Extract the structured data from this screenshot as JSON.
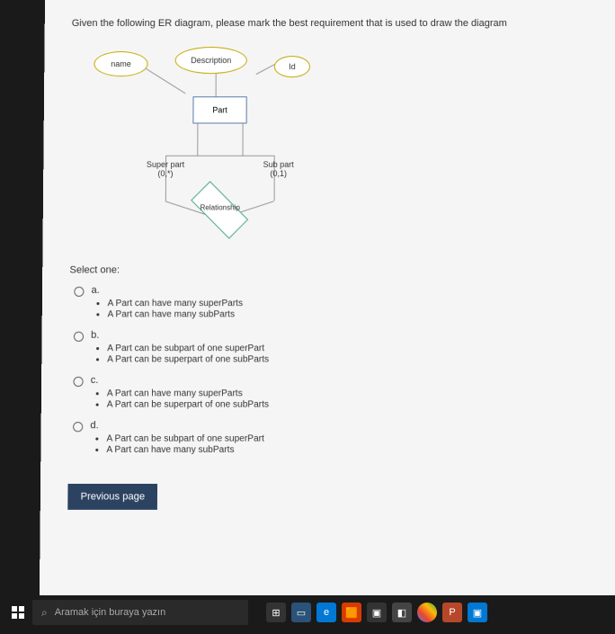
{
  "question": "Given the following ER diagram, please mark the best requirement that is used to draw the diagram",
  "diagram": {
    "attr_name": "name",
    "attr_desc": "Description",
    "attr_id": "Id",
    "entity": "Part",
    "role_super": "Super part",
    "card_super": "(0,*)",
    "role_sub": "Sub part",
    "card_sub": "(0,1)",
    "relationship": "Relationship"
  },
  "select_label": "Select one:",
  "options": {
    "a": {
      "letter": "a.",
      "line1": "A Part can have many superParts",
      "line2": "A Part can have many subParts"
    },
    "b": {
      "letter": "b.",
      "line1": "A Part can be subpart of one superPart",
      "line2": "A Part can be superpart of one subParts"
    },
    "c": {
      "letter": "c.",
      "line1": "A Part can have many superParts",
      "line2": "A Part can be superpart of one subParts"
    },
    "d": {
      "letter": "d.",
      "line1": "A Part can be subpart of one superPart",
      "line2": "A Part can have many subParts"
    }
  },
  "prev_button": "Previous page",
  "taskbar": {
    "search_placeholder": "Aramak için buraya yazın"
  }
}
